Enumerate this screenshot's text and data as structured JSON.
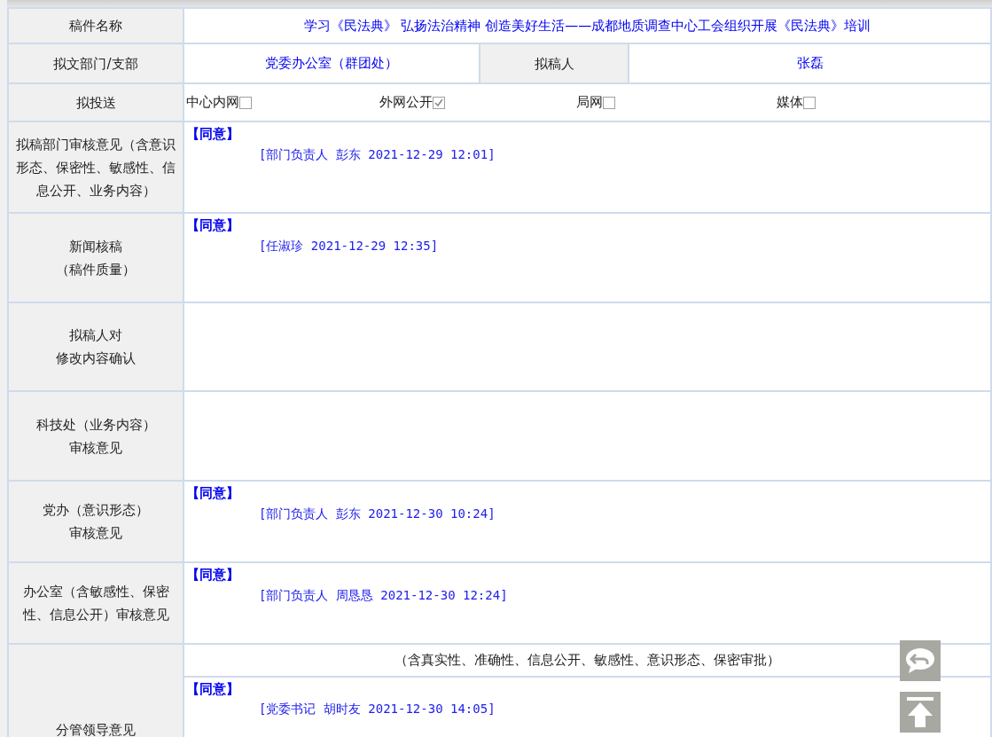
{
  "title_row": {
    "label": "稿件名称",
    "value": "学习《民法典》 弘扬法治精神 创造美好生活——成都地质调查中心工会组织开展《民法典》培训"
  },
  "dept_row": {
    "label": "拟文部门/支部",
    "value": "党委办公室（群团处）",
    "author_label": "拟稿人",
    "author": "张磊"
  },
  "send_row": {
    "label": "拟投送",
    "options": [
      {
        "label": "中心内网",
        "checked": false
      },
      {
        "label": "外网公开",
        "checked": true
      },
      {
        "label": "局网",
        "checked": false
      },
      {
        "label": "媒体",
        "checked": false
      }
    ]
  },
  "review_rows": [
    {
      "label_lines": [
        "拟稿部门审核意见（含意识形态、保密性、敏感性、信息公开、业务内容）"
      ],
      "opinion": "【同意】",
      "signature": "[部门负责人 彭东 2021-12-29 12:01]"
    },
    {
      "label_lines": [
        "新闻核稿",
        "（稿件质量）"
      ],
      "opinion": "【同意】",
      "signature": "[任淑珍 2021-12-29 12:35]"
    },
    {
      "label_lines": [
        "拟稿人对",
        "修改内容确认"
      ]
    },
    {
      "label_lines": [
        "科技处（业务内容）",
        "审核意见"
      ]
    },
    {
      "label_lines": [
        "党办（意识形态）",
        "审核意见"
      ],
      "opinion": "【同意】",
      "signature": "[部门负责人 彭东 2021-12-30 10:24]"
    },
    {
      "label_lines": [
        "办公室（含敏感性、保密性、信息公开）审核意见"
      ],
      "opinion": "【同意】",
      "signature": "[部门负责人 周恳恳 2021-12-30 12:24]"
    }
  ],
  "leader_row": {
    "label": "分管领导意见",
    "note": "（含真实性、准确性、信息公开、敏感性、意识形态、保密审批）",
    "opinion": "【同意】",
    "signature": "[党委书记 胡时友 2021-12-30 14:05]"
  }
}
